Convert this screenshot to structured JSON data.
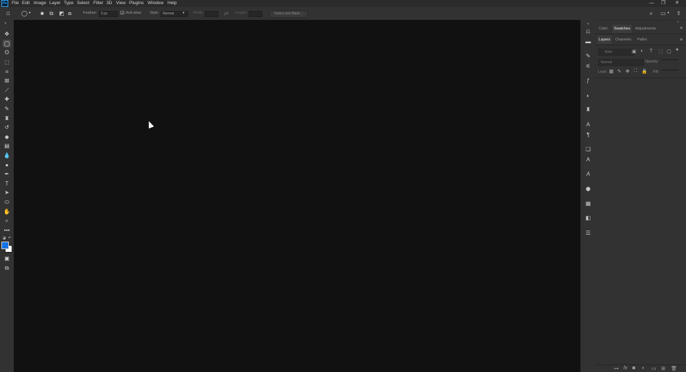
{
  "app": {
    "logo": "Ps"
  },
  "menu": [
    "File",
    "Edit",
    "Image",
    "Layer",
    "Type",
    "Select",
    "Filter",
    "3D",
    "View",
    "Plugins",
    "Window",
    "Help"
  ],
  "window_controls": {
    "minimize": "—",
    "restore": "❐",
    "close": "✕"
  },
  "options_bar": {
    "feather_label": "Feather:",
    "feather_value": "0 px",
    "anti_alias_label": "Anti-alias",
    "style_label": "Style:",
    "style_value": "Normal",
    "width_label": "Width:",
    "height_label": "Height:",
    "select_mask_label": "Select and Mask..."
  },
  "panels": {
    "top_tabs": [
      "Color",
      "Swatches",
      "Adjustments"
    ],
    "active_top_tab": "Swatches",
    "layer_tabs": [
      "Layers",
      "Channels",
      "Paths"
    ],
    "active_layer_tab": "Layers",
    "kind_placeholder": "Kind",
    "blend_mode": "Normal",
    "opacity_label": "Opacity:",
    "lock_label": "Lock:",
    "fill_label": "Fill:"
  },
  "colors": {
    "accent": "#31a8ff",
    "foreground_color": "#1473e6",
    "background_color": "#ffffff",
    "canvas_bg": "#111111",
    "ui_bg": "#323232"
  }
}
